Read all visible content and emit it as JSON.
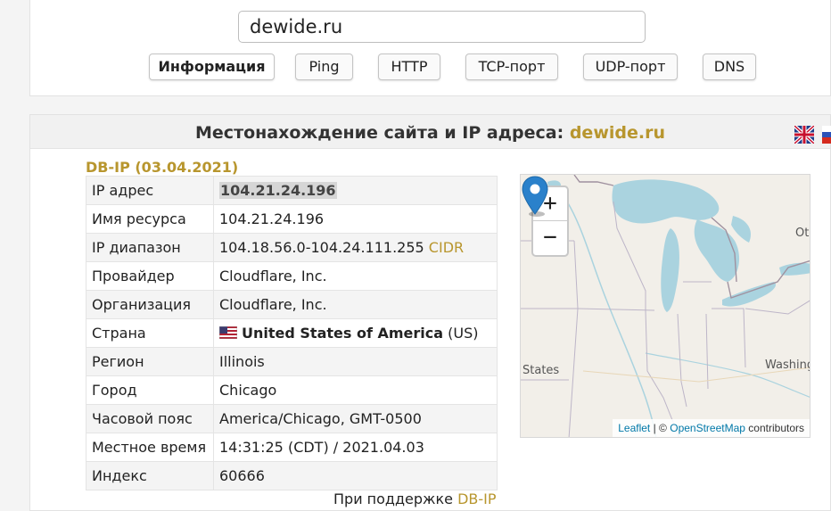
{
  "search": {
    "value": "dewide.ru"
  },
  "tools": [
    {
      "label": "Информация",
      "active": true
    },
    {
      "label": "Ping"
    },
    {
      "label": "HTTP"
    },
    {
      "label": "TCP-порт"
    },
    {
      "label": "UDP-порт"
    },
    {
      "label": "DNS"
    }
  ],
  "info": {
    "title_prefix": "Местонахождение сайта и IP адреса:",
    "title_domain": "dewide.ru",
    "source": "DB-IP (03.04.2021)",
    "rows": {
      "ip": {
        "key": "IP адрес",
        "value": "104.21.24.196"
      },
      "hostname": {
        "key": "Имя ресурса",
        "value": "104.21.24.196"
      },
      "range": {
        "key": "IP диапазон",
        "value": "104.18.56.0-104.24.111.255",
        "link": "CIDR"
      },
      "provider": {
        "key": "Провайдер",
        "value": "Cloudflare, Inc."
      },
      "org": {
        "key": "Организация",
        "value": "Cloudflare, Inc."
      },
      "country": {
        "key": "Страна",
        "name": "United States of America",
        "code": "(US)"
      },
      "region": {
        "key": "Регион",
        "value": "Illinois"
      },
      "city": {
        "key": "Город",
        "value": "Chicago"
      },
      "timezone": {
        "key": "Часовой пояс",
        "value": "America/Chicago, GMT-0500"
      },
      "localtime": {
        "key": "Местное время",
        "value": "14:31:25 (CDT) / 2021.04.03"
      },
      "zip": {
        "key": "Индекс",
        "value": "60666"
      }
    },
    "powered_prefix": "При поддержке",
    "powered_link": "DB-IP"
  },
  "map": {
    "zoom_in": "+",
    "zoom_out": "−",
    "labels": {
      "states": "States",
      "washington": "Washing",
      "ottawa": "Ot"
    },
    "attribution": {
      "leaflet": "Leaflet",
      "sep": "| ©",
      "osm": "OpenStreetMap",
      "contributors": "contributors"
    }
  },
  "colors": {
    "gold": "#b8962e",
    "water": "#aad3df",
    "link": "#0078a8",
    "marker": "#2a81cb"
  }
}
